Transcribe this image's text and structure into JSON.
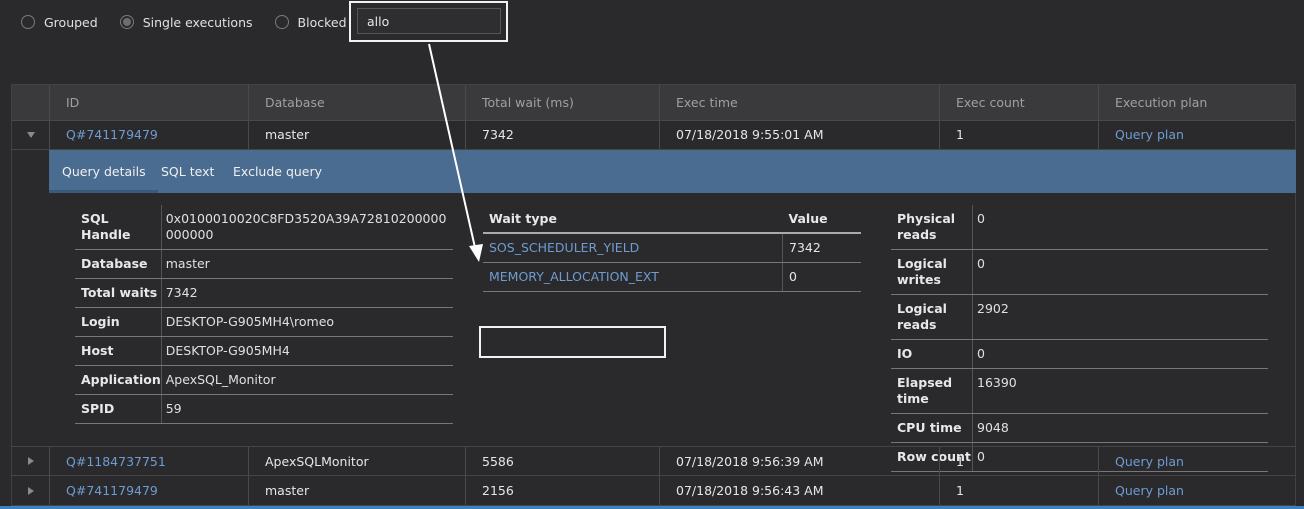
{
  "filters": {
    "options": [
      {
        "label": "Grouped",
        "selected": false
      },
      {
        "label": "Single executions",
        "selected": true
      },
      {
        "label": "Blocked",
        "selected": false
      }
    ],
    "search_value": "allo"
  },
  "grid": {
    "columns": [
      "ID",
      "Database",
      "Total wait (ms)",
      "Exec time",
      "Exec count",
      "Execution plan"
    ],
    "rows": [
      {
        "id": "Q#741179479",
        "database": "master",
        "total_wait": "7342",
        "exec_time": "07/18/2018 9:55:01 AM",
        "exec_count": "1",
        "plan": "Query plan",
        "expanded": true
      },
      {
        "id": "Q#1184737751",
        "database": "ApexSQLMonitor",
        "total_wait": "5586",
        "exec_time": "07/18/2018 9:56:39 AM",
        "exec_count": "1",
        "plan": "Query plan",
        "expanded": false
      },
      {
        "id": "Q#741179479",
        "database": "master",
        "total_wait": "2156",
        "exec_time": "07/18/2018 9:56:43 AM",
        "exec_count": "1",
        "plan": "Query plan",
        "expanded": false
      }
    ]
  },
  "detail": {
    "tabs": [
      "Query details",
      "SQL text",
      "Exclude query"
    ],
    "query_info": [
      {
        "k": "SQL Handle",
        "v": "0x0100010020C8FD3520A39A72810200000000000"
      },
      {
        "k": "Database",
        "v": "master"
      },
      {
        "k": "Total waits",
        "v": "7342"
      },
      {
        "k": "Login",
        "v": "DESKTOP-G905MH4\\romeo"
      },
      {
        "k": "Host",
        "v": "DESKTOP-G905MH4"
      },
      {
        "k": "Application",
        "v": "ApexSQL_Monitor"
      },
      {
        "k": "SPID",
        "v": "59"
      }
    ],
    "wait_headers": [
      "Wait type",
      "Value"
    ],
    "waits": [
      {
        "type": "SOS_SCHEDULER_YIELD",
        "value": "7342"
      },
      {
        "type": "MEMORY_ALLOCATION_EXT",
        "value": "0"
      }
    ],
    "io_stats": [
      {
        "k": "Physical reads",
        "v": "0"
      },
      {
        "k": "Logical writes",
        "v": "0"
      },
      {
        "k": "Logical reads",
        "v": "2902"
      },
      {
        "k": "IO",
        "v": "0"
      },
      {
        "k": "Elapsed time",
        "v": "16390"
      },
      {
        "k": "CPU time",
        "v": "9048"
      },
      {
        "k": "Row count",
        "v": "0"
      }
    ]
  },
  "colors": {
    "accent": "#496c90",
    "link": "#6f9bd1",
    "background": "#2a2a2c"
  }
}
